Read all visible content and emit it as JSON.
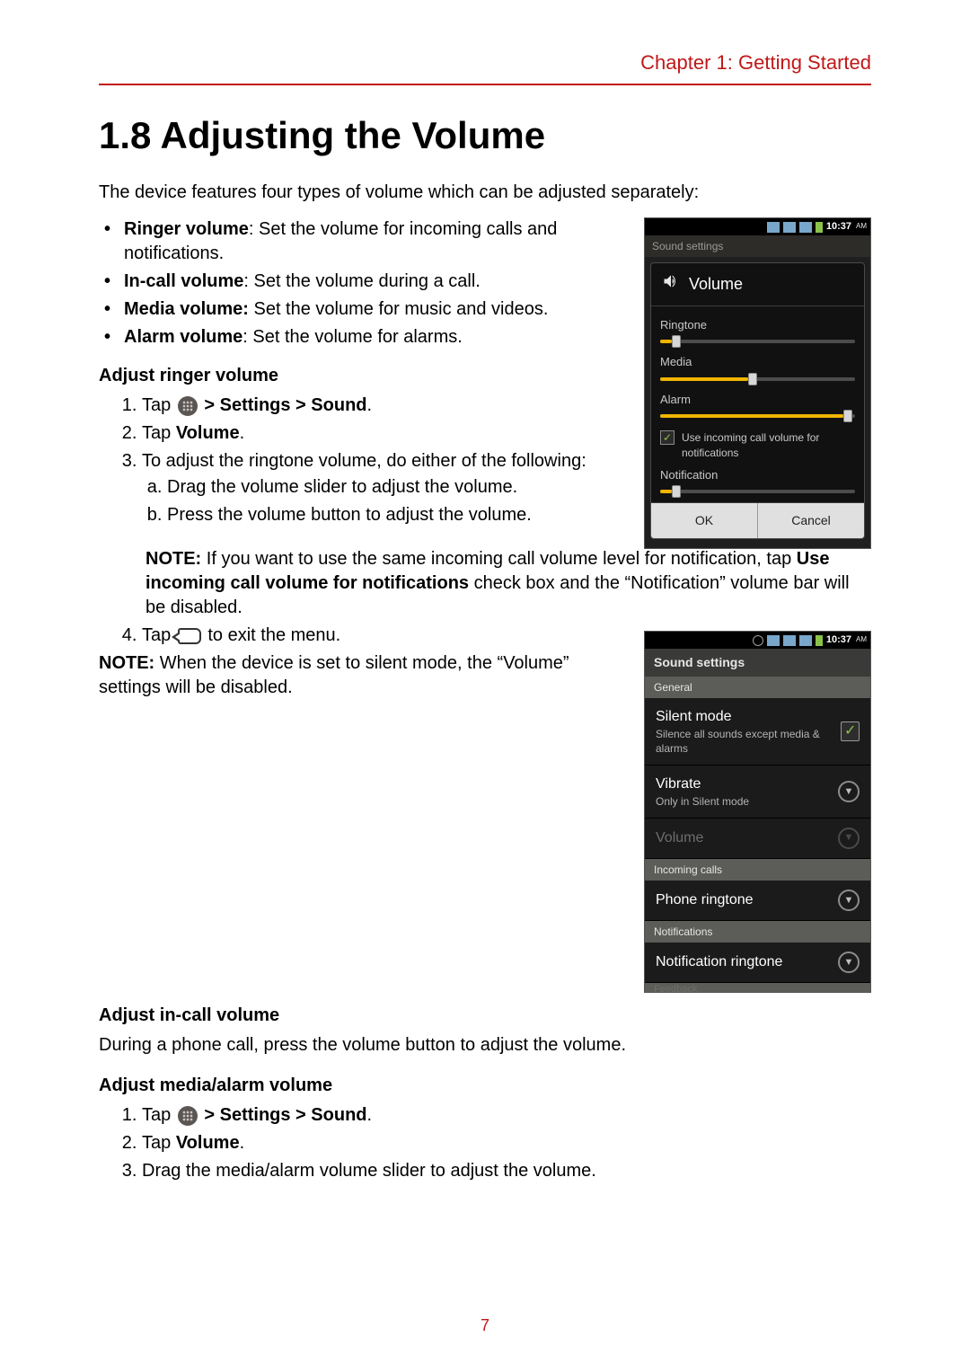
{
  "chapter_header": "Chapter 1: Getting Started",
  "section_title": "1.8 Adjusting the Volume",
  "intro": "The device features four types of volume which can be adjusted separately:",
  "vol_types": [
    {
      "name": "Ringer volume",
      "desc": ": Set the volume for incoming calls and notifications."
    },
    {
      "name": "In-call volume",
      "desc": ": Set the volume during a call."
    },
    {
      "name": "Media volume:",
      "desc": " Set the volume for music and videos."
    },
    {
      "name": "Alarm volume",
      "desc": ": Set the volume for alarms."
    }
  ],
  "sub1": "Adjust ringer volume",
  "s1_step1_pre": "Tap ",
  "s1_step1_post": " > Settings > Sound",
  "s1_step1_end": ".",
  "s1_step2_pre": "Tap ",
  "s1_step2_bold": "Volume",
  "s1_step2_end": ".",
  "s1_step3": "To adjust the ringtone volume, do either of the following:",
  "s1_step3a": "Drag the volume slider to adjust the volume.",
  "s1_step3b": "Press the volume button to adjust the volume.",
  "note1_label": "NOTE:",
  "note1_a": " If you want to use the same incoming call volume level for notification, tap ",
  "note1_bold": "Use incoming call volume for notifications",
  "note1_b": " check box and the “Notification” volume bar will be disabled.",
  "s1_step4_pre": "Tap ",
  "s1_step4_post": " to exit the menu.",
  "note2_label": "NOTE:",
  "note2_txt": " When the device is set to silent mode, the “Volume” settings will be disabled.",
  "sub2": "Adjust in-call volume",
  "s2_txt": "During a phone call, press the volume button to adjust the volume.",
  "sub3": "Adjust media/alarm volume",
  "s3_step1_pre": "Tap ",
  "s3_step1_post": " > Settings > Sound",
  "s3_step1_end": ".",
  "s3_step2_pre": "Tap ",
  "s3_step2_bold": "Volume",
  "s3_step2_end": ".",
  "s3_step3": "Drag the media/alarm volume slider to adjust the volume.",
  "page_number": "7",
  "shot1": {
    "time": "10:37",
    "ampm": "AM",
    "dim_header": "Sound settings",
    "title": "Volume",
    "sliders": [
      {
        "label": "Ringtone",
        "pct": 6
      },
      {
        "label": "Media",
        "pct": 45
      },
      {
        "label": "Alarm",
        "pct": 94
      }
    ],
    "chk_label": "Use incoming call volume for notifications",
    "notif_label": "Notification",
    "notif_pct": 6,
    "ok": "OK",
    "cancel": "Cancel"
  },
  "shot2": {
    "time": "10:37",
    "ampm": "AM",
    "title": "Sound settings",
    "cat_general": "General",
    "silent_t": "Silent mode",
    "silent_s": "Silence all sounds except media & alarms",
    "vibrate_t": "Vibrate",
    "vibrate_s": "Only in Silent mode",
    "volume_t": "Volume",
    "cat_incoming": "Incoming calls",
    "ringtone_t": "Phone ringtone",
    "cat_notif": "Notifications",
    "notif_t": "Notification ringtone",
    "cat_cut": "Feedback"
  }
}
